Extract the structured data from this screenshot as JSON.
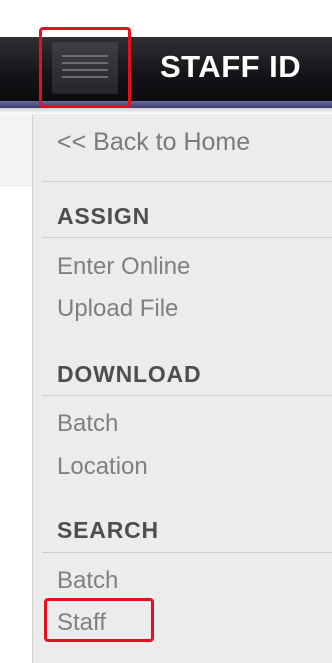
{
  "header": {
    "title": "STAFF ID"
  },
  "menu_icon": "hamburger-icon",
  "callout_color": "#e3101d",
  "sidebar": {
    "back_link": "<< Back to Home",
    "sections": [
      {
        "title": "ASSIGN",
        "items": [
          "Enter Online",
          "Upload File"
        ]
      },
      {
        "title": "DOWNLOAD",
        "items": [
          "Batch",
          "Location"
        ]
      },
      {
        "title": "SEARCH",
        "items": [
          "Batch",
          "Staff"
        ]
      }
    ]
  }
}
